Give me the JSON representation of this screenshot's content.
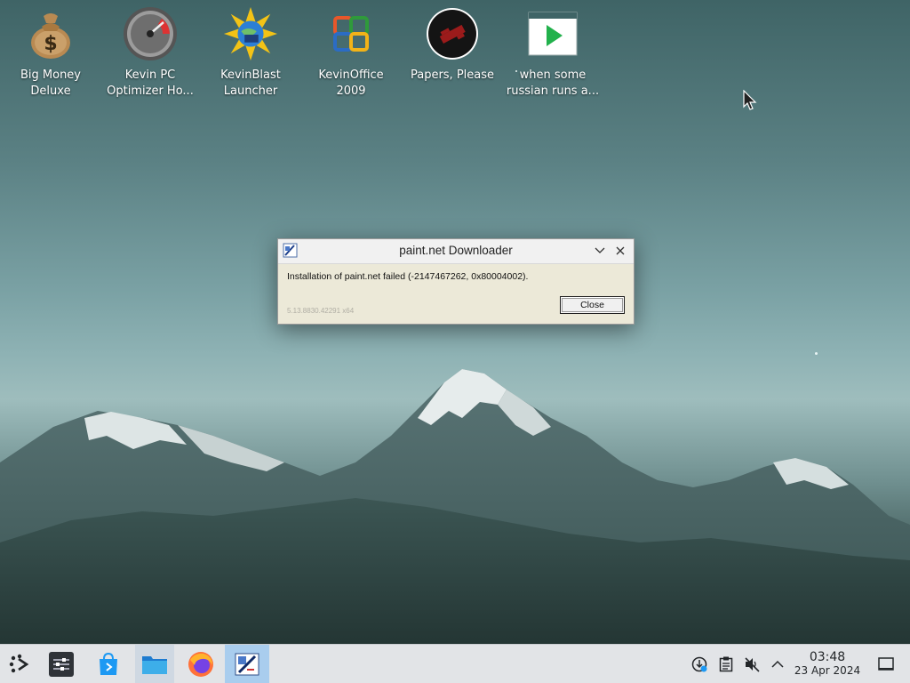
{
  "desktop": {
    "icons": [
      {
        "label_line1": "Big Money",
        "label_line2": "Deluxe",
        "icon": "money-bag-icon"
      },
      {
        "label_line1": "Kevin PC",
        "label_line2": "Optimizer Ho...",
        "icon": "speedometer-icon"
      },
      {
        "label_line1": "KevinBlast",
        "label_line2": "Launcher",
        "icon": "blast-globe-icon"
      },
      {
        "label_line1": "KevinOffice",
        "label_line2": "2009",
        "icon": "office-logo-icon"
      },
      {
        "label_line1": "Papers, Please",
        "label_line2": "",
        "icon": "papers-please-icon"
      },
      {
        "label_line1": "when some",
        "label_line2": "russian runs a...",
        "icon": "video-play-icon"
      }
    ]
  },
  "dialog": {
    "title": "paint.net Downloader",
    "message": "Installation of paint.net failed (-2147467262, 0x80004002).",
    "version": "5.13.8830.42291 x64",
    "close_label": "Close"
  },
  "taskbar": {
    "launcher_icon": "application-launcher-icon",
    "apps": [
      {
        "name": "system-settings-icon",
        "state": "normal"
      },
      {
        "name": "discover-store-icon",
        "state": "normal"
      },
      {
        "name": "file-manager-icon",
        "state": "open"
      },
      {
        "name": "firefox-icon",
        "state": "normal"
      },
      {
        "name": "paintnet-icon",
        "state": "active"
      }
    ],
    "tray": [
      "network-update-icon",
      "clipboard-icon",
      "volume-muted-icon",
      "show-hidden-icon"
    ],
    "clock": {
      "time": "03:48",
      "date": "23 Apr 2024"
    },
    "show_desktop_icon": "show-desktop-icon"
  },
  "colors": {
    "taskbar_bg": "#e2e4e7",
    "active_task": "#a9cdee",
    "dialog_bg": "#ece9d8"
  }
}
